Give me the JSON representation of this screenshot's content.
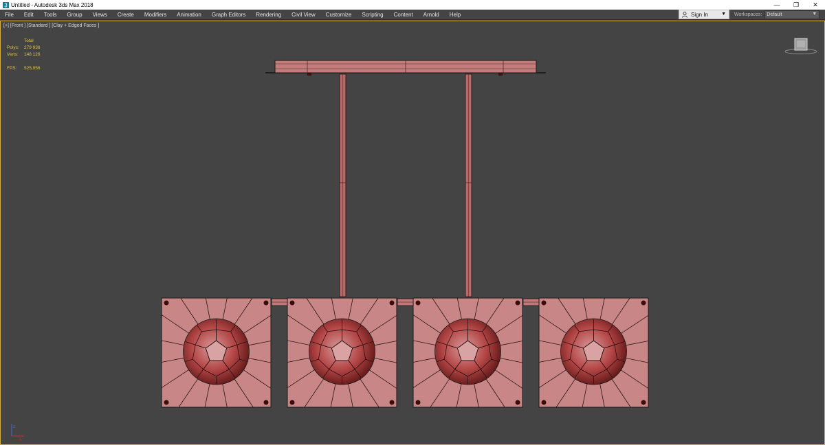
{
  "titlebar": {
    "title": "Untitled - Autodesk 3ds Max 2018",
    "minimize": "—",
    "restore": "❐",
    "close": "✕"
  },
  "menu": [
    "File",
    "Edit",
    "Tools",
    "Group",
    "Views",
    "Create",
    "Modifiers",
    "Animation",
    "Graph Editors",
    "Rendering",
    "Civil View",
    "Customize",
    "Scripting",
    "Content",
    "Arnold",
    "Help"
  ],
  "account": {
    "signin_label": "Sign In"
  },
  "workspaces": {
    "label": "Workspaces:",
    "value": "Default"
  },
  "viewport": {
    "label": "[+] [Front ] [Standard ] [Clay + Edged Faces ]",
    "stats": {
      "header": "Total",
      "polys_label": "Polys:",
      "polys_value": "279 936",
      "verts_label": "Verts:",
      "verts_value": "148 126",
      "fps_label": "FPS:",
      "fps_value": "525,956"
    }
  },
  "colors": {
    "viewport_bg": "#444444",
    "clay": "#c07878",
    "clay_dark": "#8e3a3a",
    "ball": "#b34545",
    "edge": "#1a1a1a",
    "stats_text": "#e0c14a",
    "viewport_border": "#d4b040"
  }
}
